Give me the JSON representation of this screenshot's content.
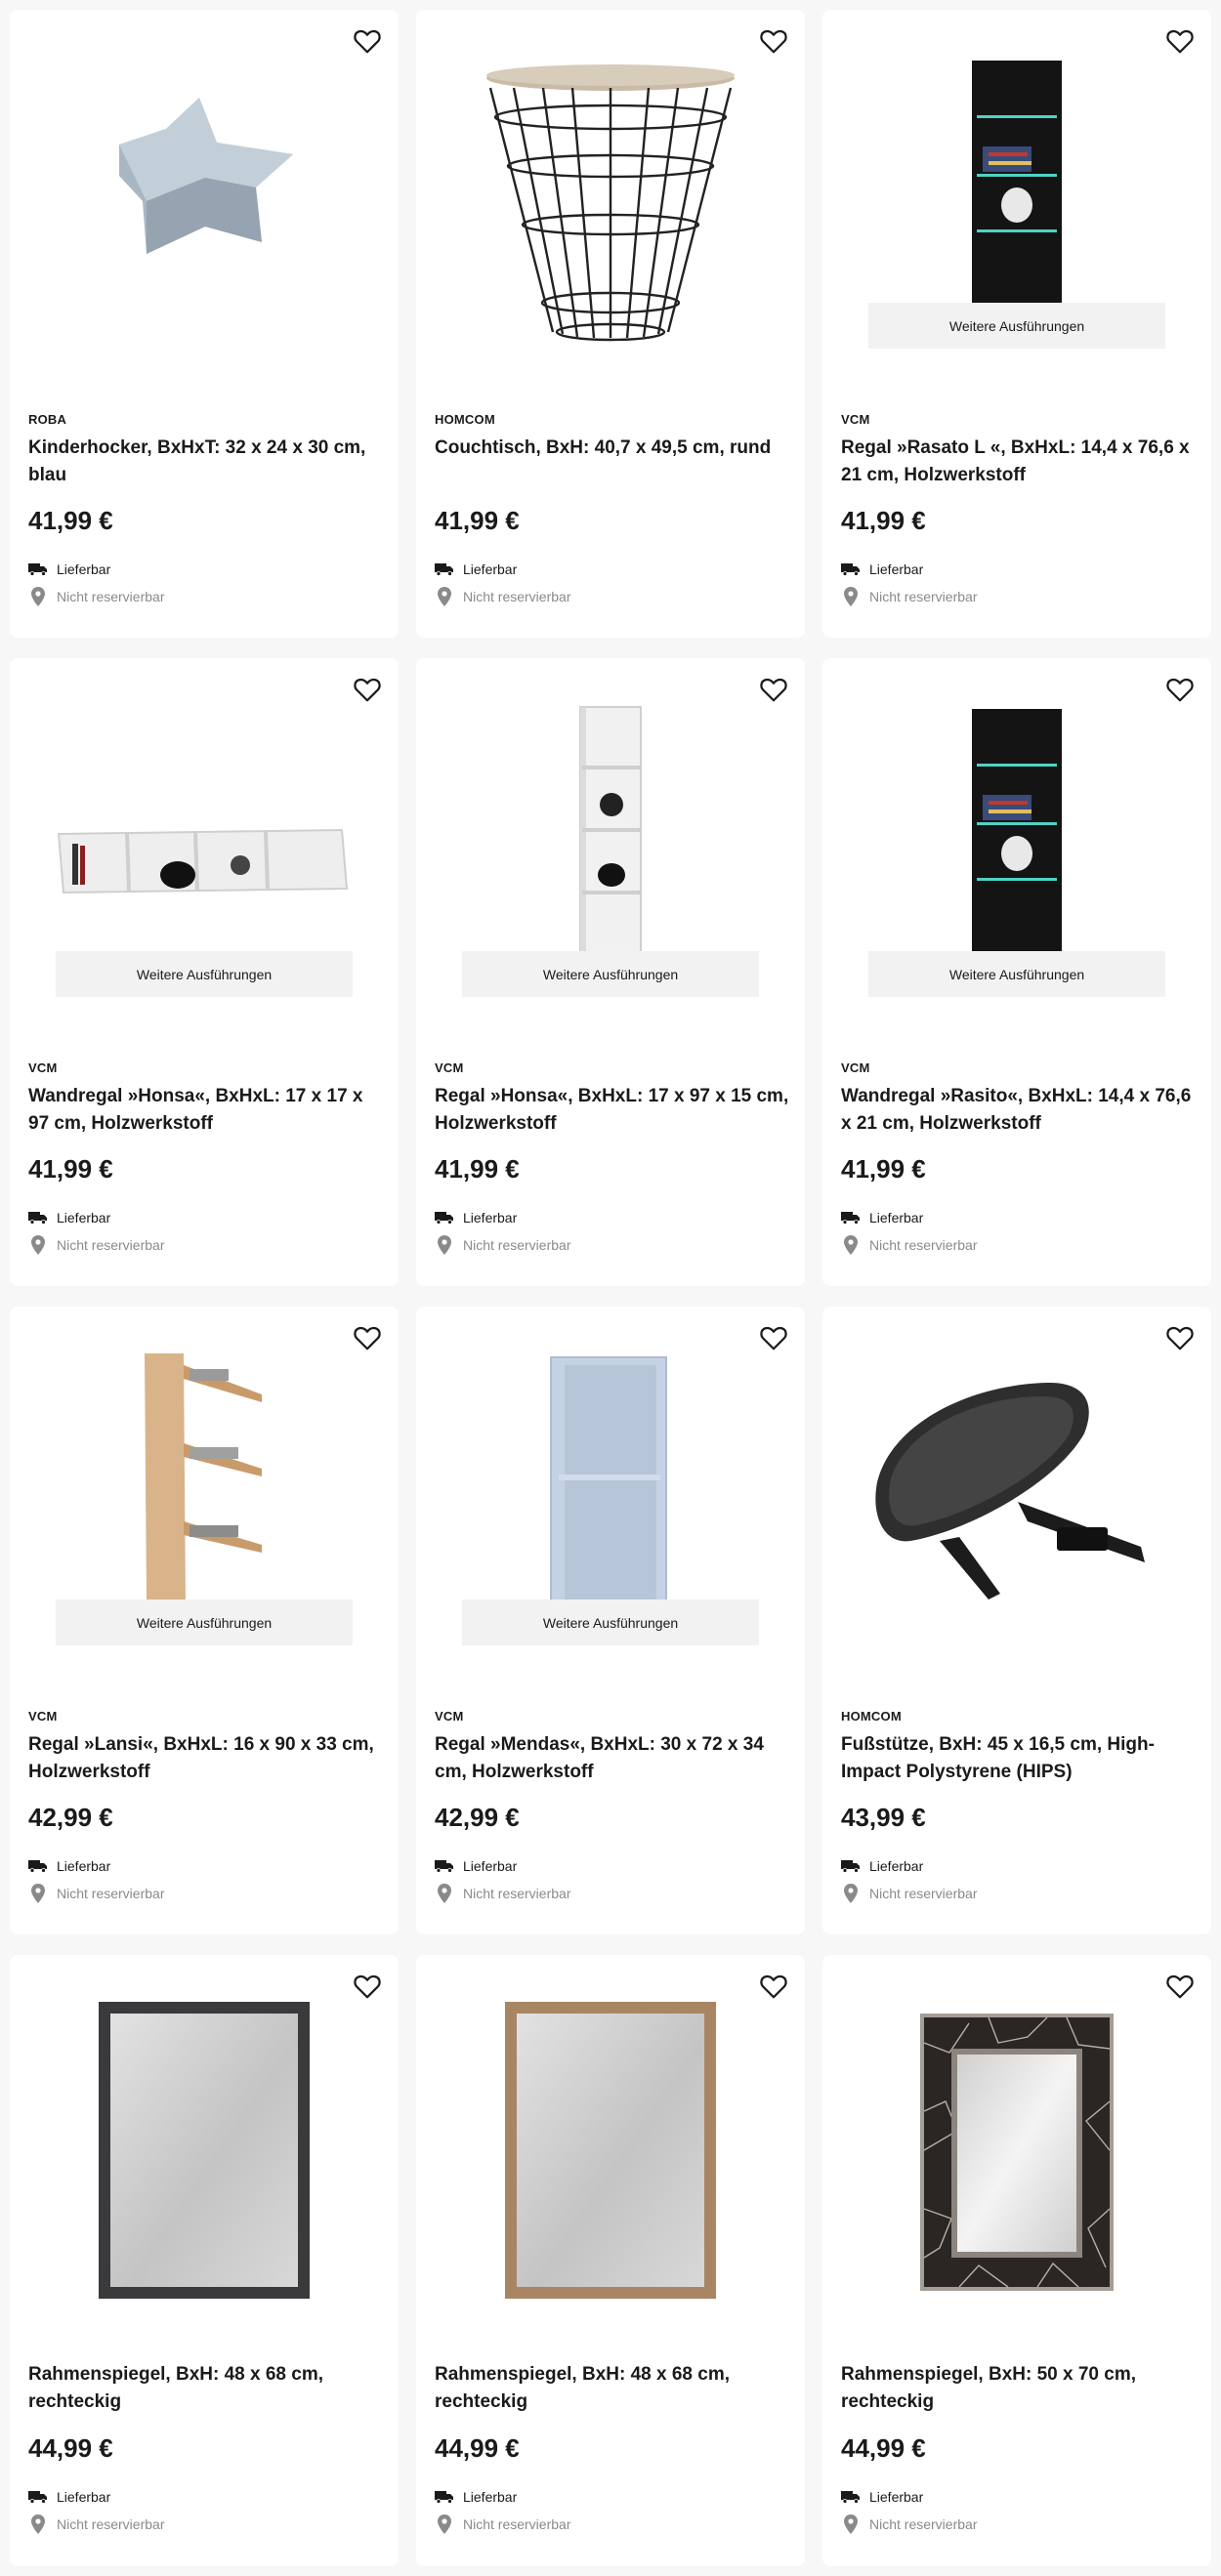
{
  "products": [
    {
      "brand": "ROBA",
      "title": "Kinderhocker, BxHxT: 32 x 24 x 30 cm, blau",
      "price": "41,99 €",
      "delivery": "Lieferbar",
      "reserve": "Nicht reservierbar",
      "image": "star-stool",
      "variants": null
    },
    {
      "brand": "HOMCOM",
      "title": "Couchtisch, BxH: 40,7 x 49,5 cm, rund",
      "price": "41,99 €",
      "delivery": "Lieferbar",
      "reserve": "Nicht reservierbar",
      "image": "wire-basket-table",
      "variants": null
    },
    {
      "brand": "VCM",
      "title": "Regal »Rasato L «, BxHxL: 14,4 x 76,6 x 21 cm, Holzwerkstoff",
      "price": "41,99 €",
      "delivery": "Lieferbar",
      "reserve": "Nicht reservierbar",
      "image": "black-media-shelf",
      "variants": "Weitere Ausführungen"
    },
    {
      "brand": "VCM",
      "title": "Wandregal »Honsa«, BxHxL: 17 x 17 x 97 cm, Holzwerkstoff",
      "price": "41,99 €",
      "delivery": "Lieferbar",
      "reserve": "Nicht reservierbar",
      "image": "white-wall-shelf",
      "variants": "Weitere Ausführungen"
    },
    {
      "brand": "VCM",
      "title": "Regal »Honsa«, BxHxL: 17 x 97 x 15 cm, Holzwerkstoff",
      "price": "41,99 €",
      "delivery": "Lieferbar",
      "reserve": "Nicht reservierbar",
      "image": "white-tall-shelf",
      "variants": "Weitere Ausführungen"
    },
    {
      "brand": "VCM",
      "title": "Wandregal »Rasito«, BxHxL: 14,4 x 76,6 x 21 cm, Holzwerkstoff",
      "price": "41,99 €",
      "delivery": "Lieferbar",
      "reserve": "Nicht reservierbar",
      "image": "black-media-shelf",
      "variants": "Weitere Ausführungen"
    },
    {
      "brand": "VCM",
      "title": "Regal »Lansi«, BxHxL: 16 x 90 x 33 cm, Holzwerkstoff",
      "price": "42,99 €",
      "delivery": "Lieferbar",
      "reserve": "Nicht reservierbar",
      "image": "oak-cd-shelf",
      "variants": "Weitere Ausführungen"
    },
    {
      "brand": "VCM",
      "title": "Regal »Mendas«, BxHxL: 30 x 72 x 34 cm, Holzwerkstoff",
      "price": "42,99 €",
      "delivery": "Lieferbar",
      "reserve": "Nicht reservierbar",
      "image": "light-blue-shelf",
      "variants": "Weitere Ausführungen"
    },
    {
      "brand": "HOMCOM",
      "title": "Fußstütze, BxH: 45 x 16,5 cm, High-Impact Polystyrene (HIPS)",
      "price": "43,99 €",
      "delivery": "Lieferbar",
      "reserve": "Nicht reservierbar",
      "image": "footrest",
      "variants": null
    },
    {
      "brand": "",
      "title": "Rahmenspiegel, BxH: 48 x 68 cm, rechteckig",
      "price": "44,99 €",
      "delivery": "Lieferbar",
      "reserve": "Nicht reservierbar",
      "image": "mirror-dark-frame",
      "variants": null
    },
    {
      "brand": "",
      "title": "Rahmenspiegel, BxH: 48 x 68 cm, rechteckig",
      "price": "44,99 €",
      "delivery": "Lieferbar",
      "reserve": "Nicht reservierbar",
      "image": "mirror-wood-frame",
      "variants": null
    },
    {
      "brand": "",
      "title": "Rahmenspiegel, BxH: 50 x 70 cm, rechteckig",
      "price": "44,99 €",
      "delivery": "Lieferbar",
      "reserve": "Nicht reservierbar",
      "image": "mirror-mosaic-frame",
      "variants": null
    }
  ],
  "icons": {
    "favorite": "heart-outline-icon",
    "delivery": "truck-icon",
    "reserve": "location-pin-icon"
  },
  "colors": {
    "card_bg": "#ffffff",
    "page_bg": "#f7f7f7",
    "variants_bg": "#f2f2f2",
    "muted_text": "#8a8a8a"
  }
}
